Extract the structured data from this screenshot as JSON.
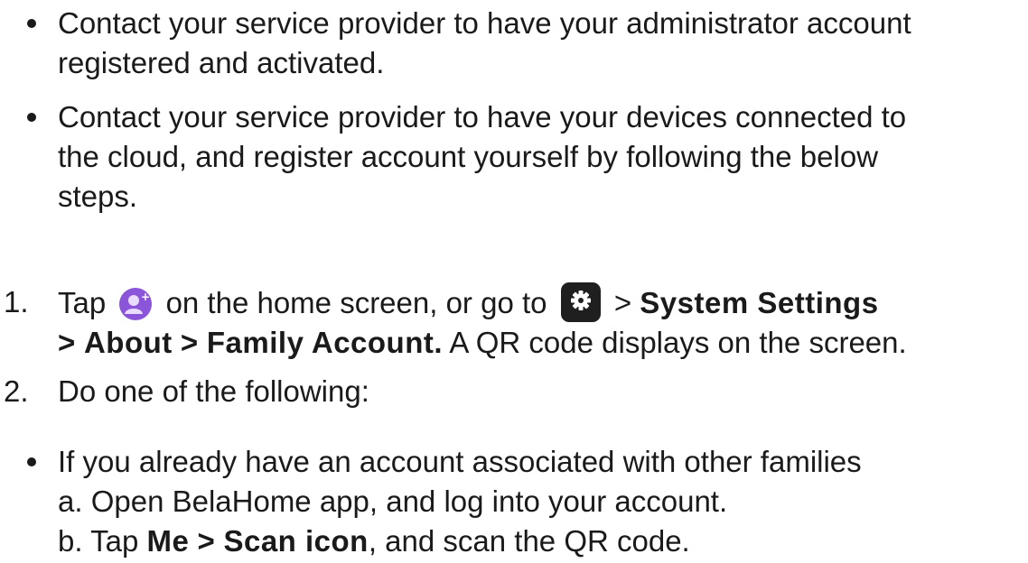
{
  "bullets_top": [
    {
      "line1": "Contact your service provider to have your administrator account",
      "line2": "registered and activated."
    },
    {
      "line1": "Contact your service provider to have your devices connected to",
      "line2": "the cloud, and register account yourself by following the below",
      "line3": "steps."
    }
  ],
  "steps": [
    {
      "marker": "1.",
      "tap": "Tap",
      "icon1": "family-account-icon",
      "mid": "on the home screen, or go to",
      "icon2": "settings-icon",
      "gt1": ">",
      "bold1": "System Settings",
      "line2_gt1": ">",
      "bold2": "About",
      "line2_gt2": ">",
      "bold3": "Family Account.",
      "after": "A QR code displays on the screen."
    },
    {
      "marker": "2.",
      "text": "Do one of the following:"
    }
  ],
  "sub_bullet": {
    "line1": "If you already have an account associated with other families",
    "sub_a": "a. Open BelaHome app, and log into your account.",
    "sub_b_prefix": "b. Tap",
    "sub_b_bold1": "Me",
    "sub_b_gt": ">",
    "sub_b_bold2": "Scan icon",
    "sub_b_suffix": ", and scan the QR code."
  },
  "colors": {
    "text": "#1a1a1a",
    "family_icon": "#8a55d8",
    "settings_icon": "#1f1f1f"
  }
}
